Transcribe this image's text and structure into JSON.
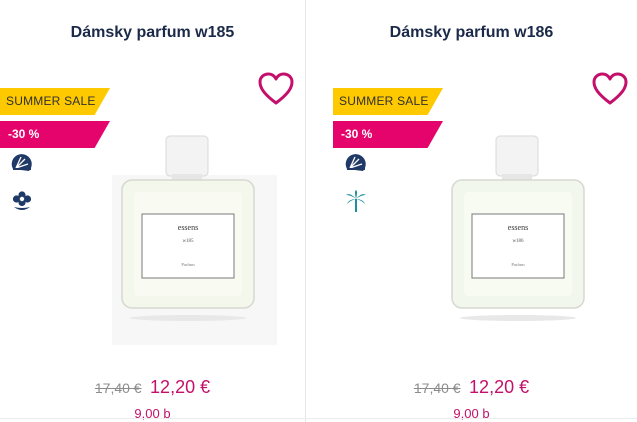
{
  "products": [
    {
      "title": "Dámsky parfum w185",
      "sale_badge": "SUMMER SALE",
      "discount_badge": "-30 %",
      "old_price": "17,40 €",
      "new_price": "12,20 €",
      "points": "9,00 b",
      "label_brand": "essens",
      "label_code": "w185",
      "label_type": "Parfum",
      "icons": [
        "citrus-icon",
        "flower-icon"
      ]
    },
    {
      "title": "Dámsky parfum w186",
      "sale_badge": "SUMMER SALE",
      "discount_badge": "-30 %",
      "old_price": "17,40 €",
      "new_price": "12,20 €",
      "points": "9,00 b",
      "label_brand": "essens",
      "label_code": "w186",
      "label_type": "Parfum",
      "icons": [
        "citrus-icon",
        "palm-icon"
      ]
    }
  ],
  "colors": {
    "accent": "#c4106a",
    "sale": "#ffc900",
    "discount": "#e5046c",
    "icon": "#1f3a66",
    "title": "#1c2a4a"
  }
}
